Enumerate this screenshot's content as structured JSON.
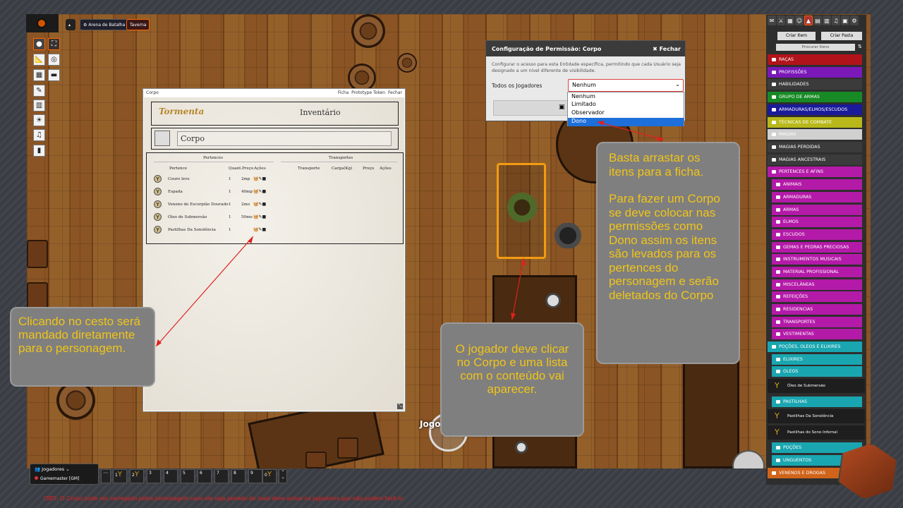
{
  "top": {
    "pages": [
      "Arena de Batalha",
      "Taverna"
    ]
  },
  "sheet": {
    "title": "Corpo",
    "links": [
      "Ficha",
      "Prototype Token",
      "Fechar"
    ],
    "logo": "Tormenta",
    "heading": "Inventário",
    "name": "Corpo",
    "pertences_title": "Pertences",
    "transportes_title": "Transportes",
    "cols": [
      "Pertence",
      "Quant.",
      "Preço",
      "Ações"
    ],
    "tcols": [
      "Transporte",
      "Carga(Kg)",
      "Preço",
      "Ações"
    ],
    "items": [
      {
        "name": "Couro leve",
        "qty": "1",
        "price": "2mp"
      },
      {
        "name": "Espada",
        "qty": "1",
        "price": "40mp"
      },
      {
        "name": "Veneno de Escorpião Dourado",
        "qty": "1",
        "price": "2mo"
      },
      {
        "name": "Óleo de Submersão",
        "qty": "1",
        "price": "50mo"
      },
      {
        "name": "Pastilhas Da Sonolência",
        "qty": "1",
        "price": ""
      }
    ]
  },
  "perm": {
    "title": "Configuração de Permissão: Corpo",
    "close": "Fechar",
    "desc": "Configurar o acesso para esta Entidade específica, permitindo que cada Usuário seja designado a um nível diferente de visibilidade.",
    "label": "Todos os Jogadores",
    "value": "Nenhum",
    "options": [
      "Nenhum",
      "Limitado",
      "Observador",
      "Dono"
    ],
    "selected": "Dono"
  },
  "notes": {
    "left": "Clicando no cesto será mandado diretamente para o personagem.",
    "mid": "O jogador deve clicar no Corpo e uma lista com o conteúdo vai aparecer.",
    "right1": "Basta arrastar os itens para a ficha.",
    "right2": "Para fazer um Corpo se deve colocar nas permissões como Dono assim os itens são levados para os pertences do personagem e serão deletados do Corpo"
  },
  "players": {
    "title": "Jogadores",
    "gm": "Gamemaster [GM]"
  },
  "hotbar": [
    "1",
    "2",
    "3",
    "4",
    "5",
    "6",
    "7",
    "8",
    "9",
    "0"
  ],
  "token_label": "Jogo",
  "side": {
    "create_item": "Criar Item",
    "create_folder": "Criar Pasta",
    "search": "Procurar Itens",
    "cats": [
      {
        "label": "RAÇAS",
        "color": "#b0141a"
      },
      {
        "label": "PROFISSÕES",
        "color": "#7a18b8"
      },
      {
        "label": "HABILIDADES",
        "color": "#3b3b3b"
      },
      {
        "label": "GRUPO DE ARMAS",
        "color": "#178a25"
      },
      {
        "label": "ARMADURAS/ELMOS/ESCUDOS",
        "color": "#1a1a9a"
      },
      {
        "label": "TÉCNICAS DE COMBATE",
        "color": "#b8b81a"
      },
      {
        "label": "MAGIAS",
        "color": "#d0d0d0"
      },
      {
        "label": "MAGIAS PERDIDAS",
        "color": "#3b3b3b"
      },
      {
        "label": "MAGIAS ANCESTRAIS",
        "color": "#3b3b3b"
      },
      {
        "label": "PERTENCES E AFINS",
        "color": "#b41aa8"
      }
    ],
    "subcats": [
      "ANIMAIS",
      "ARMADURAS",
      "ARMAS",
      "ELMOS",
      "ESCUDOS",
      "GEMAS E PEDRAS PRECIOSAS",
      "INSTRUMENTOS MUSICAIS",
      "MATERIAL PROFISSIONAL",
      "MISCELÂNEAS",
      "REFEIÇÕES",
      "RESIDENCIAS",
      "TRANSPORTES",
      "VESTIMENTAS"
    ],
    "pocoes": "POÇÕES, OLEOS E ELIXIRES",
    "elixires": "ELIXIRES",
    "oleos": "OLEOS",
    "oleo_item": "Óleo de Submersão",
    "pastilhas": "PASTILHAS",
    "past_items": [
      "Pastilhas Da Sonolência",
      "Pastilhas do Sono Infernal"
    ],
    "pocoes2": "POÇÕES",
    "unguentos": "UNGUENTOS",
    "venenos": "VENENOS E DROGAS"
  },
  "footer": "OBS: O Corpo pode ser carregado pelos personagem caso ele seja pesado de mais deve avisar os jogadores que não podem fazê-lo"
}
